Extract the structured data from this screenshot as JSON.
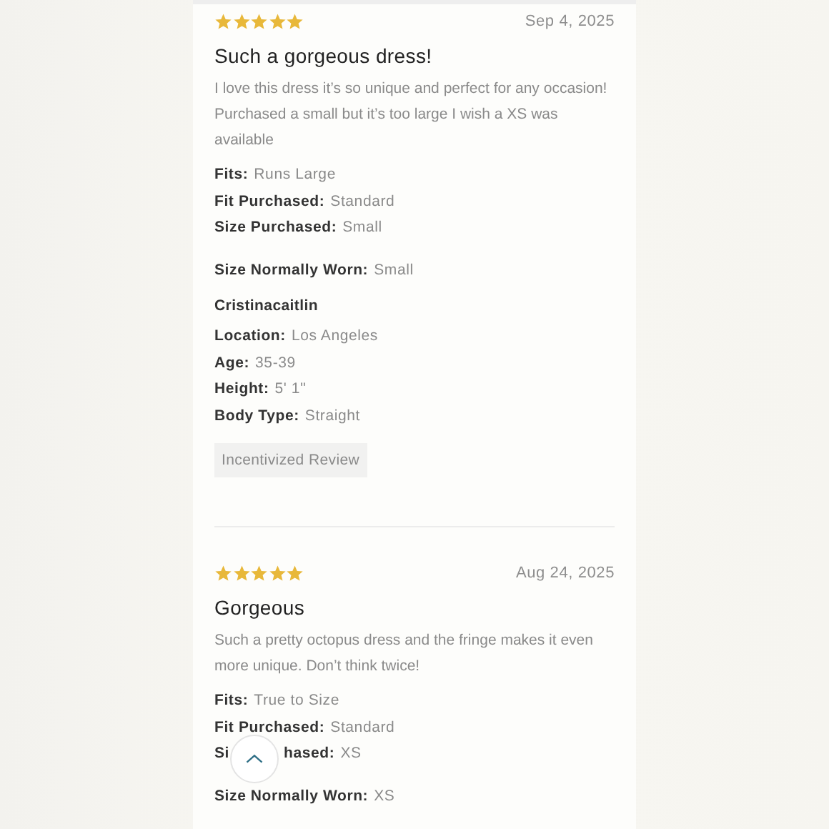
{
  "reviews": [
    {
      "stars": 5,
      "date": "Sep 4, 2025",
      "title": "Such a gorgeous dress!",
      "body": "I love this dress it’s so unique and perfect for any occasion! Purchased a small but it’s too large I wish a XS was available",
      "fit_details": [
        {
          "kind": "plain",
          "label": "Fits:",
          "value": "Runs Large"
        },
        {
          "kind": "plain",
          "label": "Fit Purchased:",
          "value": "Standard"
        },
        {
          "kind": "plain",
          "label": "Size Purchased:",
          "value": "Small"
        }
      ],
      "size_worn": {
        "label": "Size Normally Worn:",
        "value": "Small"
      },
      "reviewer": {
        "name": "Cristinacaitlin",
        "details": [
          {
            "label": "Location:",
            "value": "Los Angeles"
          },
          {
            "label": "Age:",
            "value": "35-39"
          },
          {
            "label": "Height:",
            "value": "5' 1\""
          },
          {
            "label": "Body Type:",
            "value": "Straight"
          }
        ]
      },
      "badge": "Incentivized Review"
    },
    {
      "stars": 5,
      "date": "Aug 24, 2025",
      "title": "Gorgeous",
      "body": "Such a pretty octopus dress and the fringe makes it even more unique. Don’t think twice!",
      "fit_details": [
        {
          "kind": "plain",
          "label": "Fits:",
          "value": "True to Size"
        },
        {
          "kind": "plain",
          "label": "Fit Purchased:",
          "value": "Standard"
        },
        {
          "kind": "covered",
          "label": "Si",
          "label_after": "hased:",
          "value": "XS"
        }
      ],
      "size_worn": {
        "label": "Size Normally Worn:",
        "value": "XS"
      }
    }
  ]
}
